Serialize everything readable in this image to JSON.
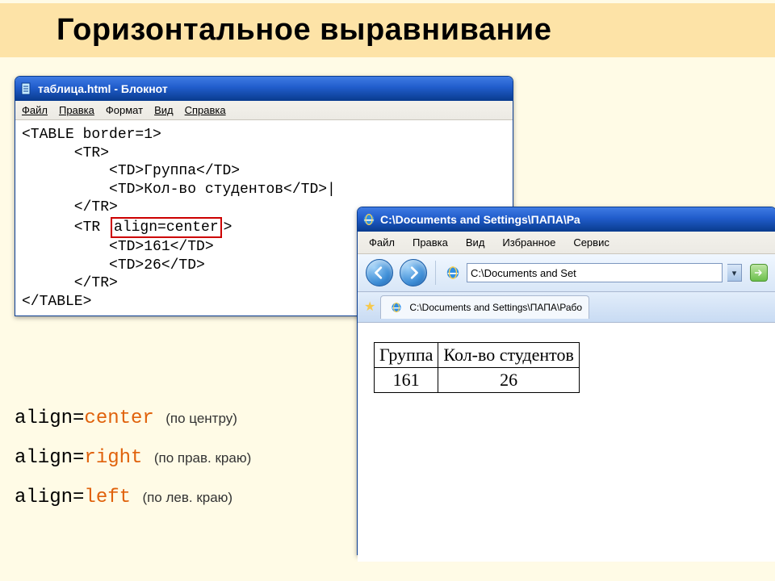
{
  "page": {
    "title": "Горизонтальное выравнивание"
  },
  "notepad": {
    "title": "таблица.html - Блокнот",
    "menu": {
      "file": "Файл",
      "edit": "Правка",
      "format": "Формат",
      "view": "Вид",
      "help": "Справка"
    },
    "code": {
      "l1": "<TABLE border=1>",
      "l2": "      <TR>",
      "l3": "          <TD>Группа</TD>",
      "l4": "          <TD>Кол-во студентов</TD>|",
      "l5": "      </TR>",
      "l6a": "      <TR ",
      "l6b": "align=center",
      "l6c": ">",
      "l7": "          <TD>161</TD>",
      "l8": "          <TD>26</TD>",
      "l9": "      </TR>",
      "l10": "</TABLE>"
    }
  },
  "ie": {
    "title": "C:\\Documents and Settings\\ПАПА\\Ра",
    "menu": {
      "file": "Файл",
      "edit": "Правка",
      "view": "Вид",
      "fav": "Избранное",
      "tools": "Сервис"
    },
    "address_short": "C:\\Documents and Set",
    "tab": "C:\\Documents and Settings\\ПАПА\\Рабо",
    "table": {
      "h1": "Группа",
      "h2": "Кол-во студентов",
      "v1": "161",
      "v2": "26"
    }
  },
  "explain": {
    "r1a": "align=",
    "r1b": "center",
    "r1c": "(по центру)",
    "r2a": "align=",
    "r2b": "right",
    "r2c": "(по прав. краю)",
    "r3a": "align=",
    "r3b": "left",
    "r3c": "(по лев. краю)"
  }
}
